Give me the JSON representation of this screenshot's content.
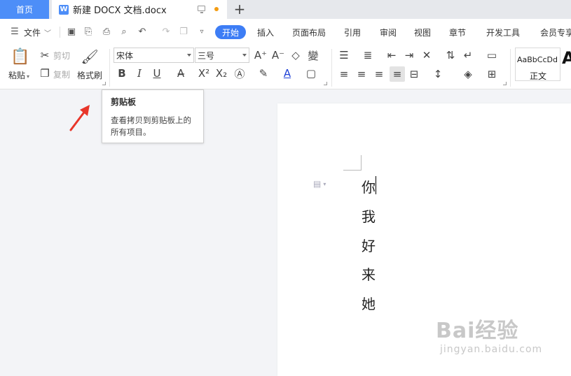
{
  "tabs": {
    "home_label": "首页",
    "doc_title": "新建 DOCX 文档.docx",
    "doc_icon_letter": "W",
    "new_tab_symbol": "+"
  },
  "menu": {
    "file_label": "文件",
    "items": [
      "开始",
      "插入",
      "页面布局",
      "引用",
      "审阅",
      "视图",
      "章节",
      "开发工具",
      "会员专享"
    ],
    "active_index": 0
  },
  "ribbon": {
    "paste": "粘贴",
    "cut": "剪切",
    "copy": "复制",
    "format_painter": "格式刷",
    "font_name": "宋体",
    "font_size": "三号",
    "bold": "B",
    "italic": "I",
    "underline": "U",
    "font_color_letter": "A",
    "style_preview": "AaBbCcDd",
    "style_name": "正文",
    "style_big_letter": "A"
  },
  "tooltip": {
    "title": "剪贴板",
    "body": "查看拷贝到剪贴板上的所有项目。"
  },
  "document": {
    "lines": [
      "你",
      "我",
      "好",
      "来",
      "她"
    ]
  },
  "watermark": {
    "main": "Bai经验",
    "sub": "jingyan.baidu.com"
  },
  "colors": {
    "accent": "#3d7df5",
    "home_tab": "#4d8ef8",
    "arrow": "#e8362a"
  }
}
